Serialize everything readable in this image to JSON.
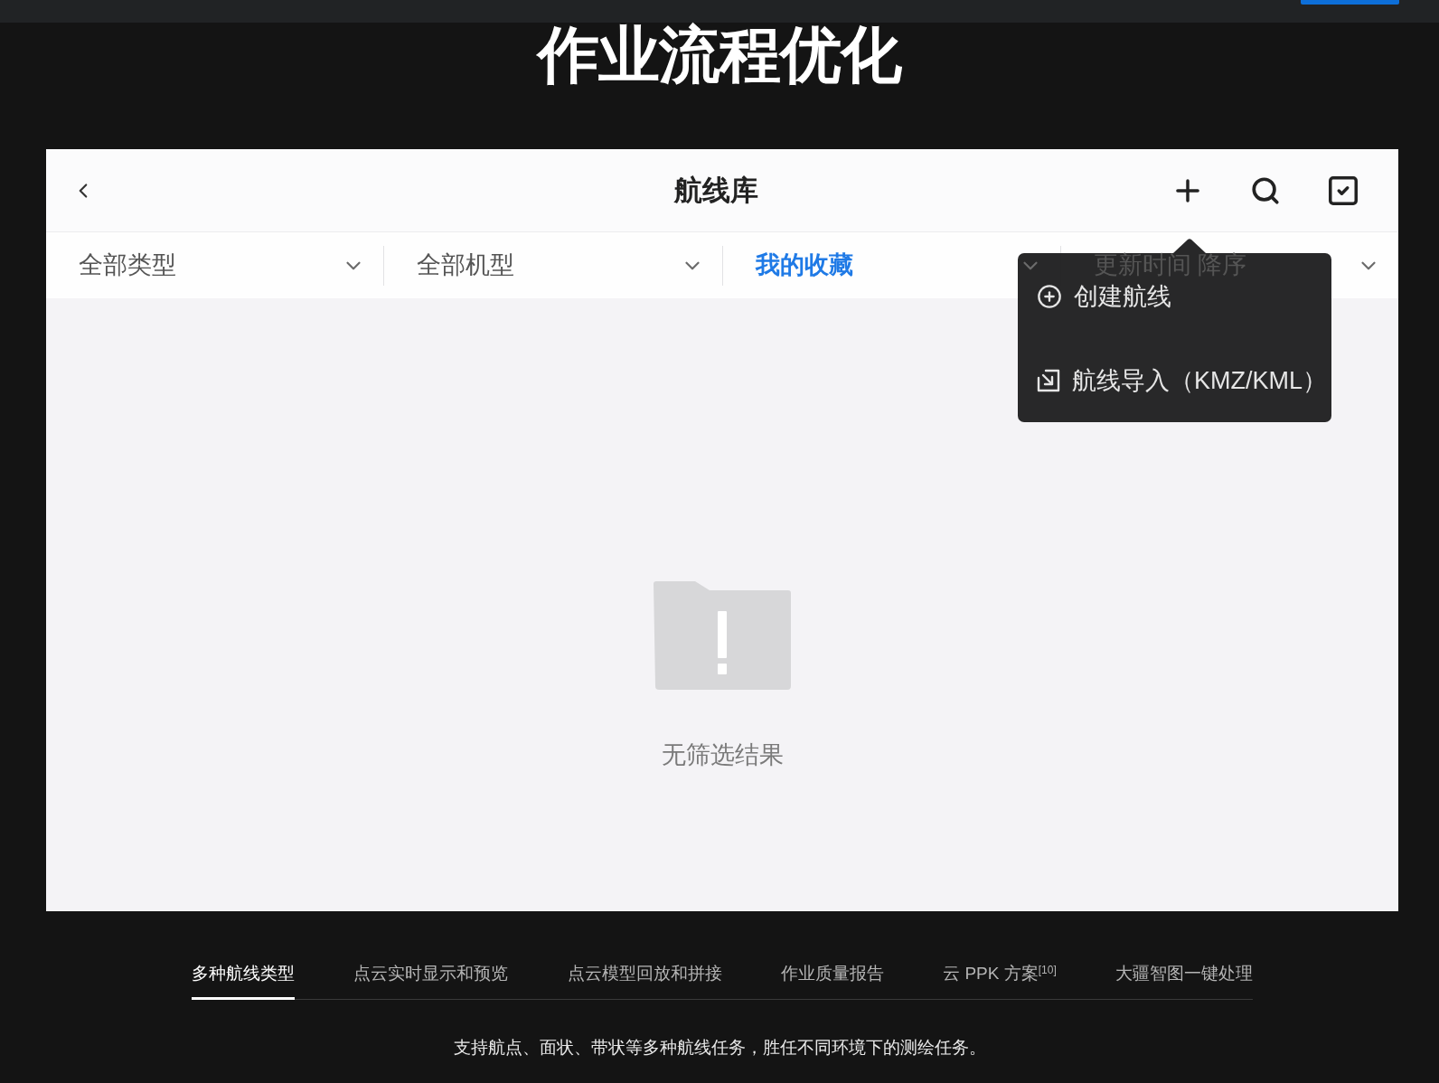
{
  "heading": "作业流程优化",
  "app": {
    "header": {
      "title": "航线库"
    },
    "filters": [
      {
        "label": "全部类型",
        "selected": false
      },
      {
        "label": "全部机型",
        "selected": false
      },
      {
        "label": "我的收藏",
        "selected": true
      },
      {
        "label": "更新时间 降序",
        "selected": false
      }
    ],
    "popup_menu": {
      "items": [
        {
          "kind": "create",
          "label": "创建航线"
        },
        {
          "kind": "import",
          "label": "航线导入（KMZ/KML）"
        }
      ]
    },
    "empty_state": {
      "message": "无筛选结果"
    }
  },
  "feature_tabs": [
    {
      "label": "多种航线类型",
      "selected": true
    },
    {
      "label": "点云实时显示和预览",
      "selected": false
    },
    {
      "label": "点云模型回放和拼接",
      "selected": false
    },
    {
      "label": "作业质量报告",
      "selected": false
    },
    {
      "label": "云 PPK 方案$^{[10]}$",
      "selected": false
    },
    {
      "label": "大疆智图一键处理",
      "selected": false
    }
  ],
  "description": "支持航点、面状、带状等多种航线任务，胜任不同环境下的测绘任务。"
}
